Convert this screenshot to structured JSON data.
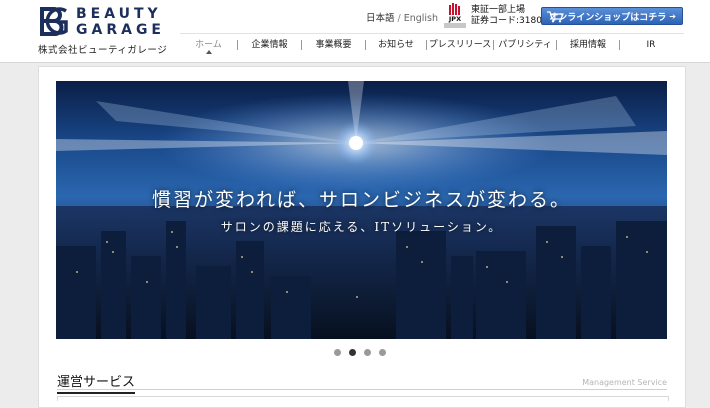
{
  "header": {
    "brand_line1": "BEAUTY",
    "brand_line2": "GARAGE",
    "company_name": "株式会社ビューティガレージ",
    "lang_ja": "日本語",
    "lang_sep": "/",
    "lang_en": "English",
    "jpx_label": "JPX",
    "listing_line1": "東証一部上場",
    "listing_line2": "証券コード:3180",
    "shop_button": "オンラインショップはコチラ",
    "brand_color": "#1c2f5c",
    "button_color": "#2c63b5"
  },
  "nav": {
    "items": [
      {
        "label": "ホーム",
        "active": true
      },
      {
        "label": "企業情報",
        "active": false
      },
      {
        "label": "事業概要",
        "active": false
      },
      {
        "label": "お知らせ",
        "active": false
      },
      {
        "label": "プレスリリース",
        "active": false
      },
      {
        "label": "パブリシティ",
        "active": false
      },
      {
        "label": "採用情報",
        "active": false
      },
      {
        "label": "IR",
        "active": false
      }
    ]
  },
  "hero": {
    "headline": "慣習が変われば、サロンビジネスが変わる。",
    "subline": "サロンの課題に応える、ITソリューション。"
  },
  "slider": {
    "count": 4,
    "active_index": 1
  },
  "section": {
    "title": "運営サービス",
    "subtitle": "Management Service"
  }
}
